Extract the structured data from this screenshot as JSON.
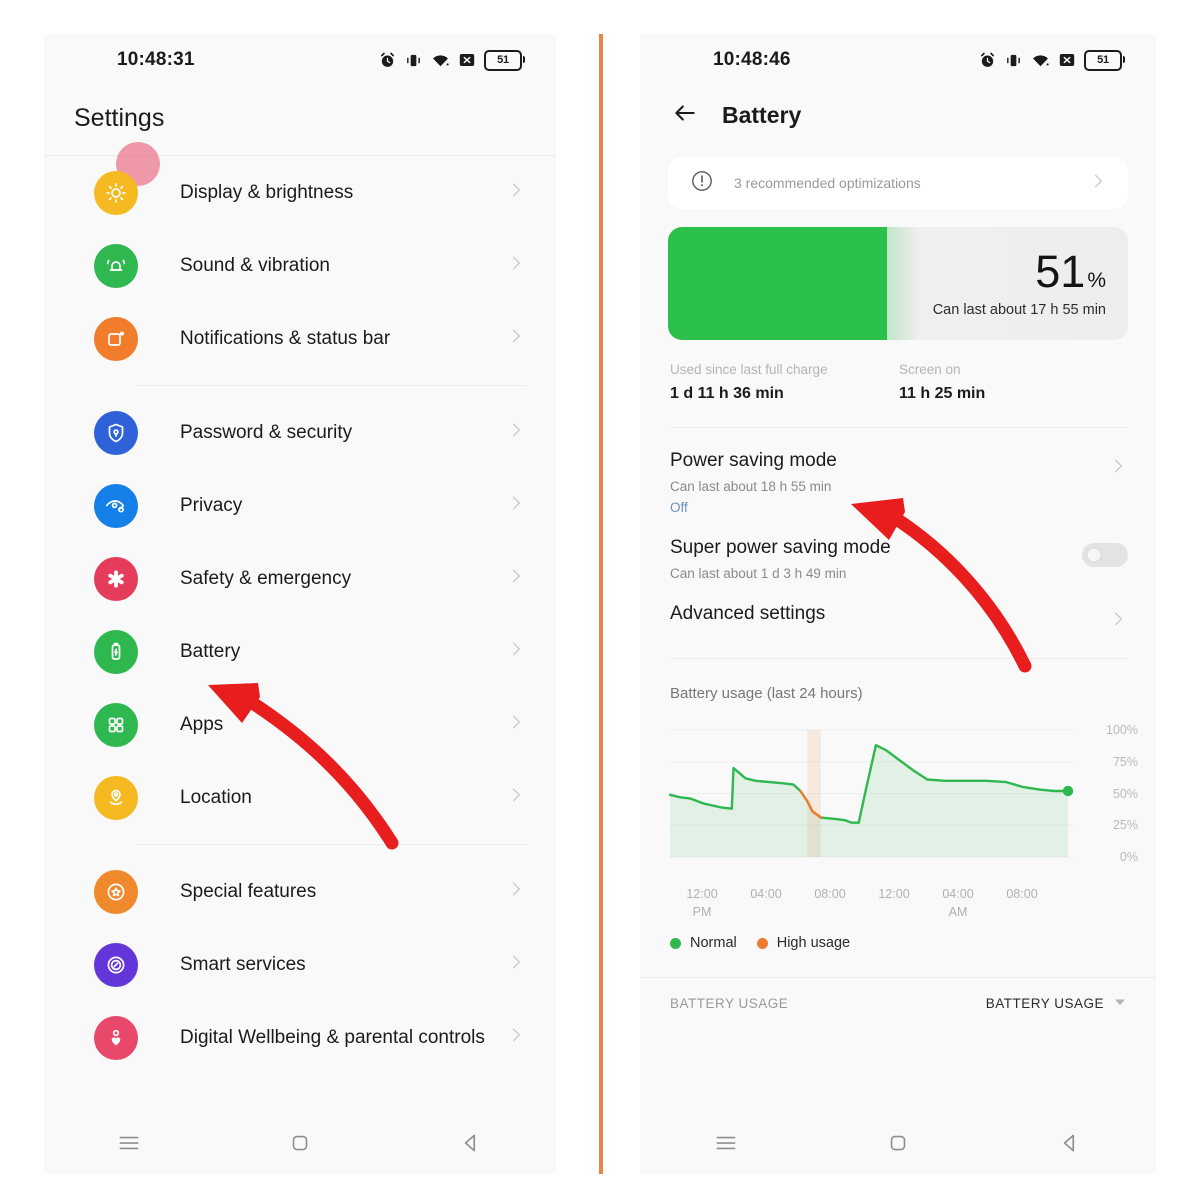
{
  "colors": {
    "accent_green": "#2bc04a",
    "accent_orange": "#ef7c2e",
    "annotation_red": "#e81d1d",
    "divider_orange": "#e8854a",
    "panel_bg": "#f9f9f9"
  },
  "left_panel": {
    "status_bar": {
      "time": "10:48:31",
      "icons": [
        "alarm-icon",
        "vibrate-icon",
        "wifi-icon",
        "x-badge-icon",
        "battery-icon"
      ],
      "battery_level": "51"
    },
    "title": "Settings",
    "groups": [
      {
        "items": [
          {
            "label": "Display & brightness",
            "icon": "brightness-icon",
            "color": "#f5b921"
          },
          {
            "label": "Sound & vibration",
            "icon": "bell-icon",
            "color": "#2eb84f"
          },
          {
            "label": "Notifications & status bar",
            "icon": "notification-icon",
            "color": "#f07c2c"
          }
        ]
      },
      {
        "items": [
          {
            "label": "Password & security",
            "icon": "shield-lock-icon",
            "color": "#2f62d8"
          },
          {
            "label": "Privacy",
            "icon": "eye-icon",
            "color": "#1480e8"
          },
          {
            "label": "Safety & emergency",
            "icon": "asterisk-medical-icon",
            "color": "#e63c5c"
          },
          {
            "label": "Battery",
            "icon": "battery-icon",
            "color": "#2eb84f"
          },
          {
            "label": "Apps",
            "icon": "grid-apps-icon",
            "color": "#2eb84f"
          },
          {
            "label": "Location",
            "icon": "location-pin-icon",
            "color": "#f5b921"
          }
        ]
      },
      {
        "items": [
          {
            "label": "Special features",
            "icon": "star-circle-icon",
            "color": "#f0892c"
          },
          {
            "label": "Smart services",
            "icon": "smart-circle-icon",
            "color": "#6336d9"
          },
          {
            "label": "Digital Wellbeing & parental controls",
            "icon": "wellbeing-icon",
            "color": "#e8496a"
          }
        ]
      }
    ],
    "nav_bar": [
      "menu-icon",
      "home-icon",
      "back-icon"
    ]
  },
  "right_panel": {
    "status_bar": {
      "time": "10:48:46",
      "icons": [
        "alarm-icon",
        "vibrate-icon",
        "wifi-icon",
        "x-badge-icon",
        "battery-icon"
      ],
      "battery_level": "51"
    },
    "header": {
      "back": "back-arrow-icon",
      "title": "Battery"
    },
    "optimization_card": {
      "icon": "exclamation-circle-icon",
      "text": "3 recommended optimizations",
      "chevron": "chevron-right-icon"
    },
    "battery_card": {
      "percent_value": "51",
      "percent_symbol": "%",
      "fill_ratio": 51,
      "subtitle": "Can last about 17 h 55 min"
    },
    "stats": [
      {
        "key": "Used since last full charge",
        "value": "1 d 11 h 36 min"
      },
      {
        "key": "Screen on",
        "value": "11 h 25 min"
      }
    ],
    "settings_rows": [
      {
        "title": "Power saving mode",
        "subtitle": "Can last about 18 h 55 min",
        "status": "Off",
        "affordance": "chevron"
      },
      {
        "title": "Super power saving mode",
        "subtitle": "Can last about 1 d 3 h 49 min",
        "status": "",
        "affordance": "toggle",
        "toggle_on": false
      },
      {
        "title": "Advanced settings",
        "subtitle": "",
        "status": "",
        "affordance": "chevron"
      }
    ],
    "bottom_tabs": {
      "left_label": "BATTERY USAGE",
      "right_label": "BATTERY USAGE",
      "right_icon": "caret-down-icon"
    },
    "nav_bar": [
      "menu-icon",
      "home-icon",
      "back-icon"
    ]
  },
  "chart_data": {
    "type": "area",
    "title": "Battery usage (last 24 hours)",
    "xlabel": "",
    "ylabel": "",
    "ylim": [
      0,
      100
    ],
    "yticks": [
      "0%",
      "25%",
      "50%",
      "75%",
      "100%"
    ],
    "grid": true,
    "legend_position": "bottom-left",
    "legend": [
      {
        "name": "Normal",
        "color": "#2eb84f"
      },
      {
        "name": "High usage",
        "color": "#ef7c2e"
      }
    ],
    "xtick_labels": [
      {
        "time": "12:00",
        "meridiem": "PM"
      },
      {
        "time": "04:00",
        "meridiem": ""
      },
      {
        "time": "08:00",
        "meridiem": ""
      },
      {
        "time": "12:00",
        "meridiem": ""
      },
      {
        "time": "04:00",
        "meridiem": "AM"
      },
      {
        "time": "08:00",
        "meridiem": ""
      }
    ],
    "x": [
      11.0,
      11.6,
      12.2,
      13.0,
      14.0,
      14.6,
      14.7,
      15.4,
      16.0,
      16.8,
      17.6,
      18.2,
      18.6,
      19.0,
      19.3,
      19.8,
      20.6,
      21.2,
      21.6,
      22.0,
      22.4,
      23.0,
      23.6,
      24.4,
      25.2,
      26.0,
      27.0,
      28.2,
      29.4,
      30.6,
      31.6,
      32.6,
      33.4,
      34.2
    ],
    "values": [
      49,
      47,
      46,
      42,
      39,
      38,
      70,
      62,
      60,
      59,
      58,
      57,
      52,
      44,
      36,
      31,
      30,
      29,
      27,
      27,
      52,
      88,
      84,
      76,
      68,
      61,
      60,
      60,
      60,
      59,
      55,
      53,
      52,
      52
    ],
    "high_usage_segment": {
      "x_start": 19.0,
      "x_end": 19.8,
      "label": "High usage"
    },
    "current_point": {
      "x": 34.2,
      "y": 52
    }
  },
  "annotations": [
    {
      "name": "arrow-to-battery",
      "points_to": "Battery",
      "color": "#e81d1d"
    },
    {
      "name": "arrow-to-power-saving-mode",
      "points_to": "Power saving mode",
      "color": "#e81d1d"
    }
  ]
}
